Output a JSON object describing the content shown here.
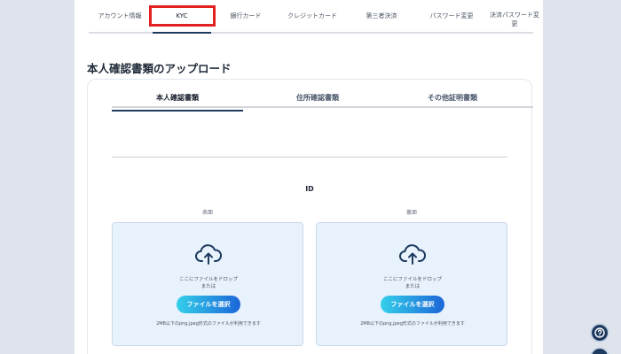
{
  "top_tabs": [
    {
      "label": "アカウント情報"
    },
    {
      "label": "KYC"
    },
    {
      "label": "銀行カード"
    },
    {
      "label": "クレジットカード"
    },
    {
      "label": "第三者決済"
    },
    {
      "label": "パスワード変更"
    },
    {
      "label": "決済パスワード変\n更"
    }
  ],
  "active_top_tab": "KYC",
  "section_title": "本人確認書類のアップロード",
  "sub_tabs": [
    {
      "label": "本人確認書類"
    },
    {
      "label": "住所確認書類"
    },
    {
      "label": "その他証明書類"
    }
  ],
  "upload": {
    "doc_label": "ID",
    "front": {
      "label": "表面",
      "drop_line1": "ここにファイルをドロップ",
      "drop_line2": "または",
      "button": "ファイルを選択",
      "hint": "2MB以下のpng,jpeg形式のファイルが利用できます"
    },
    "back": {
      "label": "裏面",
      "drop_line1": "ここにファイルをドロップ",
      "drop_line2": "または",
      "button": "ファイルを選択",
      "hint": "2MB以下のpng,jpeg形式のファイルが利用できます"
    }
  },
  "colors": {
    "accent": "#1e3a5f",
    "highlight": "#e32020",
    "drop_bg": "#e8f2fc",
    "button_start": "#34d0ea",
    "button_end": "#1c66d8"
  },
  "icons": {
    "upload": "cloud-upload-icon",
    "help": "help-chat-icon"
  }
}
